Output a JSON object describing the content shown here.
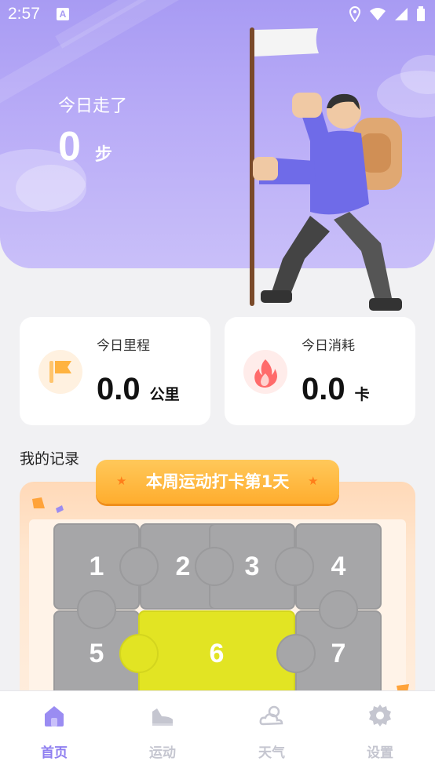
{
  "status_bar": {
    "time": "2:57"
  },
  "hero": {
    "today_label": "今日走了",
    "steps_value": "0",
    "steps_unit": "步"
  },
  "cards": {
    "distance": {
      "title": "今日里程",
      "value": "0.0",
      "unit": "公里"
    },
    "calories": {
      "title": "今日消耗",
      "value": "0.0",
      "unit": "卡"
    }
  },
  "records": {
    "title": "我的记录",
    "banner": "本周运动打卡第1天",
    "pieces": [
      "1",
      "2",
      "3",
      "4",
      "5",
      "6",
      "7"
    ],
    "active_piece": "6"
  },
  "tabs": [
    {
      "label": "首页",
      "icon": "home-icon",
      "active": true
    },
    {
      "label": "运动",
      "icon": "shoe-icon",
      "active": false
    },
    {
      "label": "天气",
      "icon": "weather-icon",
      "active": false
    },
    {
      "label": "设置",
      "icon": "gear-icon",
      "active": false
    }
  ],
  "colors": {
    "accent": "#8f7ff0",
    "hero": "#a89bf3",
    "active_piece": "#e2e423",
    "banner": "#ffad2e"
  }
}
